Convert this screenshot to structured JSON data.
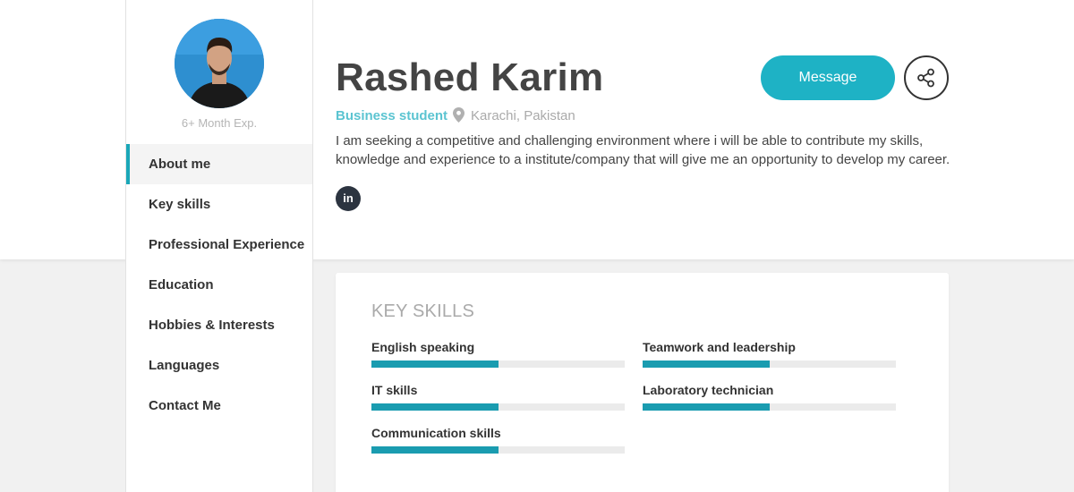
{
  "profile": {
    "name": "Rashed Karim",
    "role": "Business student",
    "location": "Karachi, Pakistan",
    "experience": "6+ Month Exp.",
    "about": "I am seeking a competitive and challenging environment where i will be able to contribute my skills, knowledge and experience to a institute/company that will give me an opportunity to develop my career."
  },
  "actions": {
    "message_label": "Message",
    "share_icon": "share-icon",
    "linkedin_label": "in"
  },
  "sidebar": {
    "items": [
      {
        "label": "About me",
        "active": true
      },
      {
        "label": "Key skills",
        "active": false
      },
      {
        "label": "Professional Experience",
        "active": false
      },
      {
        "label": "Education",
        "active": false
      },
      {
        "label": "Hobbies & Interests",
        "active": false
      },
      {
        "label": "Languages",
        "active": false
      },
      {
        "label": "Contact Me",
        "active": false
      }
    ]
  },
  "key_skills": {
    "title": "KEY SKILLS",
    "skills": [
      {
        "name": "English speaking",
        "level": 0.5
      },
      {
        "name": "Teamwork and leadership",
        "level": 0.5
      },
      {
        "name": "IT skills",
        "level": 0.5
      },
      {
        "name": "Laboratory technician",
        "level": 0.5
      },
      {
        "name": "Communication skills",
        "level": 0.5
      }
    ]
  },
  "colors": {
    "accent": "#1eb2c5",
    "bar_fill": "#1a9cb0",
    "role_text": "#5bc4d1"
  }
}
